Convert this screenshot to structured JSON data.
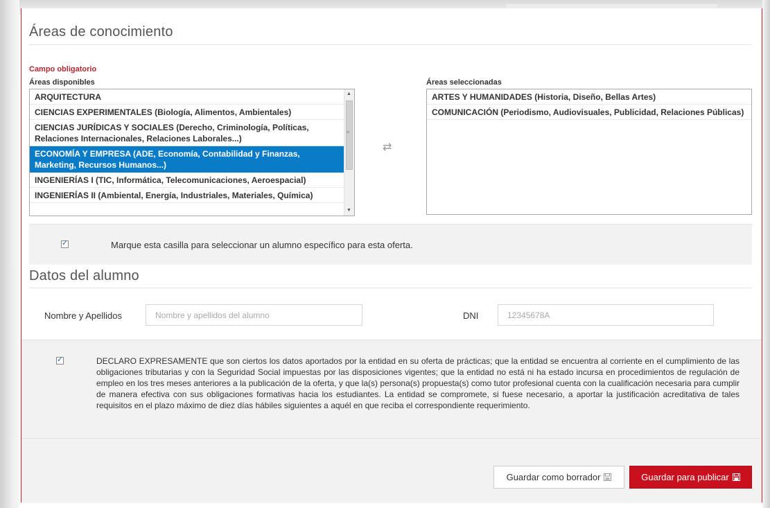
{
  "areas": {
    "title": "Áreas de conocimiento",
    "required_label": "Campo obligatorio",
    "available_caption": "Áreas disponibles",
    "selected_caption": "Áreas seleccionadas",
    "available": [
      {
        "label": "ARQUITECTURA",
        "selected": false
      },
      {
        "label": "CIENCIAS EXPERIMENTALES (Biología, Alimentos, Ambientales)",
        "selected": false
      },
      {
        "label": "CIENCIAS JURÍDICAS Y SOCIALES (Derecho, Criminología, Políticas, Relaciones Internacionales, Relaciones Laborales...)",
        "selected": false
      },
      {
        "label": "ECONOMÍA Y EMPRESA (ADE, Economía, Contabilidad y Finanzas, Marketing, Recursos Humanos...)",
        "selected": true
      },
      {
        "label": "INGENIERÍAS I (TIC, Informática, Telecomunicaciones, Aeroespacial)",
        "selected": false
      },
      {
        "label": "INGENIERÍAS II (Ambiental, Energía, Industriales, Materiales, Química)",
        "selected": false
      }
    ],
    "selected": [
      {
        "label": "ARTES Y HUMANIDADES (Historia, Diseño, Bellas Artes)"
      },
      {
        "label": "COMUNICACIÓN (Periodismo, Audiovisuales, Publicidad, Relaciones Públicas)"
      }
    ],
    "swap_icon": "swap-arrows-icon"
  },
  "specific_student": {
    "checked": true,
    "label": "Marque esta casilla para seleccionar un alumno específico para esta oferta."
  },
  "student": {
    "title": "Datos del alumno",
    "name_label": "Nombre y Apellidos",
    "name_placeholder": "Nombre y apellidos del alumno",
    "name_value": "",
    "dni_label": "DNI",
    "dni_placeholder": "12345678A",
    "dni_value": ""
  },
  "declaration": {
    "checked": true,
    "text": "DECLARO EXPRESAMENTE que son ciertos los datos aportados por la entidad en su oferta de prácticas; que la entidad se encuentra al corriente en el cumplimiento de las obligaciones tributarias y con la Seguridad Social impuestas por las disposiciones vigentes; que la entidad no está ni ha estado incursa en procedimientos de regulación de empleo en los tres meses anteriores a la publicación de la oferta, y que la(s) persona(s) propuesta(s) como tutor profesional cuenta con la cualificación necesaria para cumplir de manera efectiva con sus obligaciones formativas hacia los estudiantes. La entidad se compromete, si fuese necesario, a aportar la justificación acreditativa de tales requisitos en el plazo máximo de diez días hábiles siguientes a aquél en que reciba el correspondiente requerimiento."
  },
  "actions": {
    "draft_label": "Guardar como borrador",
    "publish_label": "Guardar para publicar",
    "save_icon": "floppy-disk-icon"
  },
  "colors": {
    "accent_red": "#c8101e",
    "selection_blue": "#0a7cc7",
    "required_red": "#b3262f"
  }
}
